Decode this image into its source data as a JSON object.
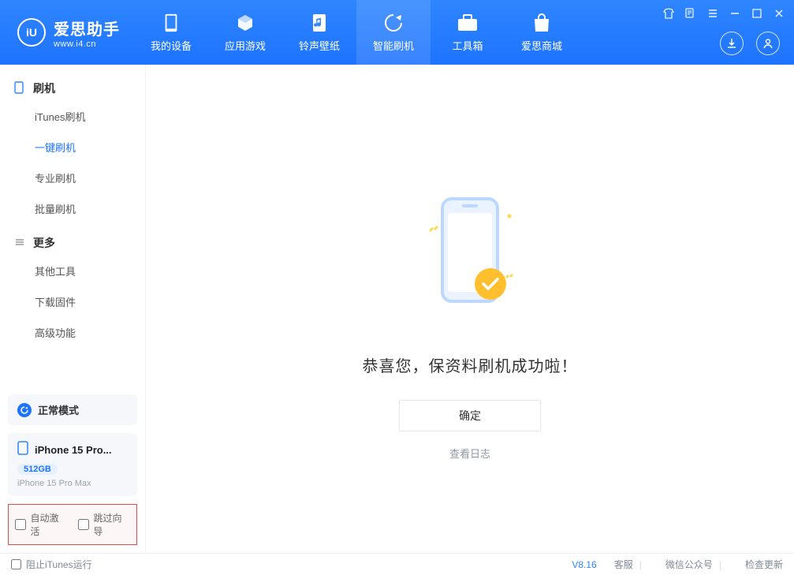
{
  "header": {
    "app_name": "爱思助手",
    "app_url": "www.i4.cn",
    "nav": [
      {
        "label": "我的设备"
      },
      {
        "label": "应用游戏"
      },
      {
        "label": "铃声壁纸"
      },
      {
        "label": "智能刷机"
      },
      {
        "label": "工具箱"
      },
      {
        "label": "爱思商城"
      }
    ]
  },
  "sidebar": {
    "group1_label": "刷机",
    "items1": [
      {
        "label": "iTunes刷机"
      },
      {
        "label": "一键刷机"
      },
      {
        "label": "专业刷机"
      },
      {
        "label": "批量刷机"
      }
    ],
    "group2_label": "更多",
    "items2": [
      {
        "label": "其他工具"
      },
      {
        "label": "下载固件"
      },
      {
        "label": "高级功能"
      }
    ],
    "status_label": "正常模式",
    "device": {
      "name_short": "iPhone 15 Pro...",
      "storage": "512GB",
      "model": "iPhone 15 Pro Max"
    },
    "opt1_label": "自动激活",
    "opt2_label": "跳过向导"
  },
  "main": {
    "success_msg": "恭喜您，保资料刷机成功啦！",
    "ok_label": "确定",
    "log_label": "查看日志"
  },
  "footer": {
    "block_itunes": "阻止iTunes运行",
    "version": "V8.16",
    "links": [
      "客服",
      "微信公众号",
      "检查更新"
    ]
  }
}
